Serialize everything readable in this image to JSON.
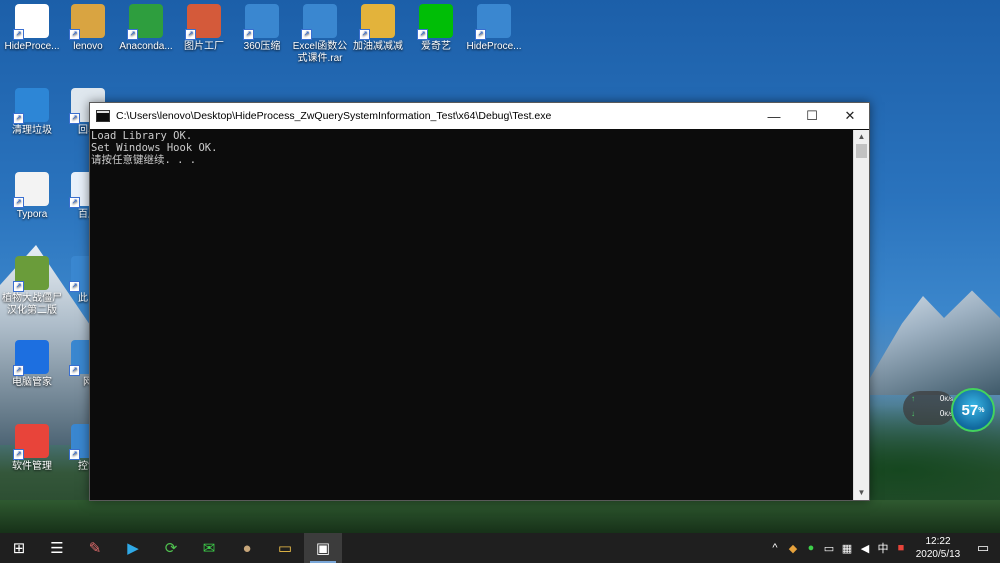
{
  "desktop_icons": [
    {
      "label": "HideProce...",
      "icon": "exe-icon",
      "color": "#ffffff"
    },
    {
      "label": "lenovo",
      "icon": "user-folder-icon",
      "color": "#d9a441"
    },
    {
      "label": "Anaconda...",
      "icon": "anaconda-icon",
      "color": "#2e9e3e"
    },
    {
      "label": "图片工厂",
      "icon": "picture-factory-icon",
      "color": "#d45a3a"
    },
    {
      "label": "360压缩",
      "icon": "archive-icon",
      "color": "#3a87d0"
    },
    {
      "label": "Excel函数公式课件.rar",
      "icon": "rar-archive-icon",
      "color": "#3a87d0"
    },
    {
      "label": "加油减减减",
      "icon": "folder-icon",
      "color": "#e3b33b"
    },
    {
      "label": "爱奇艺",
      "icon": "iqiyi-icon",
      "color": "#00be06"
    },
    {
      "label": "HideProce...",
      "icon": "archive-icon",
      "color": "#3a87d0"
    },
    {
      "label": "清理垃圾",
      "icon": "broom-icon",
      "color": "#2d86d6"
    },
    {
      "label": "回收",
      "icon": "recycle-bin-icon",
      "color": "#dfe7ee"
    },
    {
      "label": "Typora",
      "icon": "typora-icon",
      "color": "#f3f3f3"
    },
    {
      "label": "百度",
      "icon": "baidu-icon",
      "color": "#e9f1fb"
    },
    {
      "label": "植物大战僵尸汉化第二版",
      "icon": "plant-game-icon",
      "color": "#6a9c3a"
    },
    {
      "label": "此电",
      "icon": "computer-icon",
      "color": "#3a87d0"
    },
    {
      "label": "电脑管家",
      "icon": "shield-icon",
      "color": "#1d6fe0"
    },
    {
      "label": "网",
      "icon": "network-icon",
      "color": "#3a87d0"
    },
    {
      "label": "软件管理",
      "icon": "software-manager-icon",
      "color": "#e8443a"
    },
    {
      "label": "控制",
      "icon": "control-panel-icon",
      "color": "#3a87d0"
    }
  ],
  "console_window": {
    "title": "C:\\Users\\lenovo\\Desktop\\HideProcess_ZwQuerySystemInformation_Test\\x64\\Debug\\Test.exe",
    "output_lines": [
      "Load Library OK.",
      "Set Windows Hook OK.",
      "请按任意键继续. . ."
    ],
    "controls": {
      "minimize": "—",
      "maximize": "☐",
      "close": "✕"
    }
  },
  "network_widget": {
    "upload": "0",
    "upload_unit": "K/s",
    "download": "0",
    "download_unit": "K/s",
    "percent": "57",
    "percent_unit": "%"
  },
  "taskbar": {
    "start": "⊞",
    "apps": [
      {
        "name": "task-view-button",
        "glyph": "☰"
      },
      {
        "name": "paint-app-button",
        "glyph": "✎"
      },
      {
        "name": "video-player-button",
        "glyph": "▶"
      },
      {
        "name": "refresh-app-button",
        "glyph": "⟳"
      },
      {
        "name": "wechat-button",
        "glyph": "✉"
      },
      {
        "name": "avatar-app-button",
        "glyph": "●"
      },
      {
        "name": "file-explorer-button",
        "glyph": "▭"
      },
      {
        "name": "console-app-button",
        "glyph": "▣"
      }
    ],
    "tray": {
      "chevron": "^",
      "ime": "中",
      "time": "12:22",
      "date": "2020/5/13",
      "notify": "▭"
    }
  }
}
